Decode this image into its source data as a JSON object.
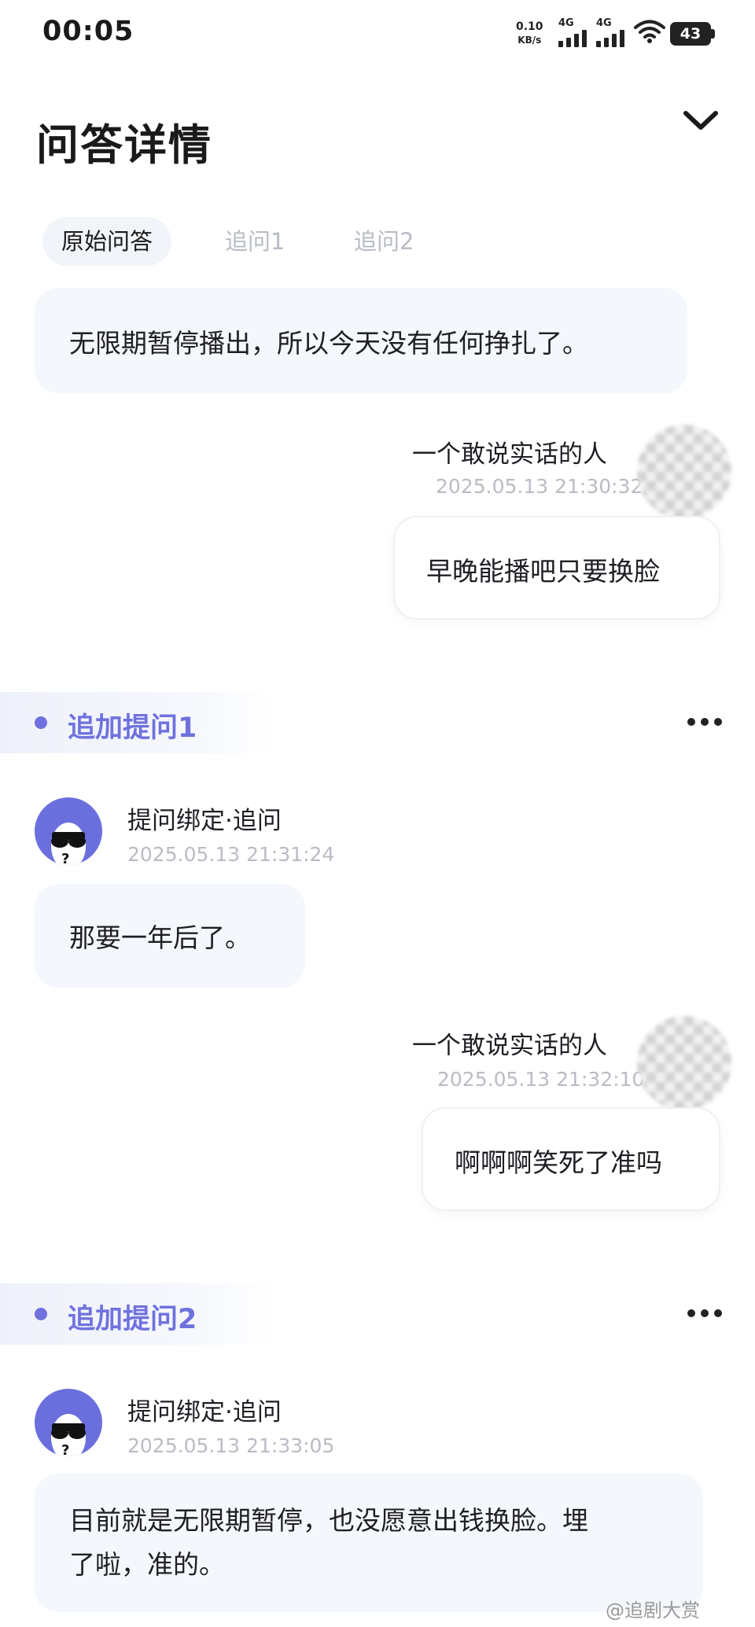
{
  "status_bar": {
    "time": "00:05",
    "speed_value": "0.10",
    "speed_unit": "KB/s",
    "signal1_label": "4G",
    "signal2_label": "4G",
    "battery": "43"
  },
  "header": {
    "title": "问答详情"
  },
  "tabs": [
    {
      "label": "原始问答"
    },
    {
      "label": "追问1"
    },
    {
      "label": "追问2"
    }
  ],
  "messages": {
    "original_answer": "无限期暂停播出，所以今天没有任何挣扎了。",
    "reply1": {
      "name": "一个敢说实话的人",
      "time": "2025.05.13 21:30:32",
      "text": "早晚能播吧只要换脸"
    },
    "section1": {
      "title": "追加提问1"
    },
    "answer1": {
      "name": "提问绑定·追问",
      "time": "2025.05.13 21:31:24",
      "text": "那要一年后了。"
    },
    "reply2": {
      "name": "一个敢说实话的人",
      "time": "2025.05.13 21:32:10",
      "text": "啊啊啊笑死了准吗"
    },
    "section2": {
      "title": "追加提问2"
    },
    "answer2": {
      "name": "提问绑定·追问",
      "time": "2025.05.13 21:33:05",
      "text_line1": "目前就是无限期暂停，也没愿意出钱换脸。埋",
      "text_line2": "了啦，准的。"
    }
  },
  "watermark": "@追剧大赏",
  "colors": {
    "accent": "#6f72dd",
    "bubble_bg": "#f4f7fb",
    "muted_text": "#b9bcc4"
  }
}
